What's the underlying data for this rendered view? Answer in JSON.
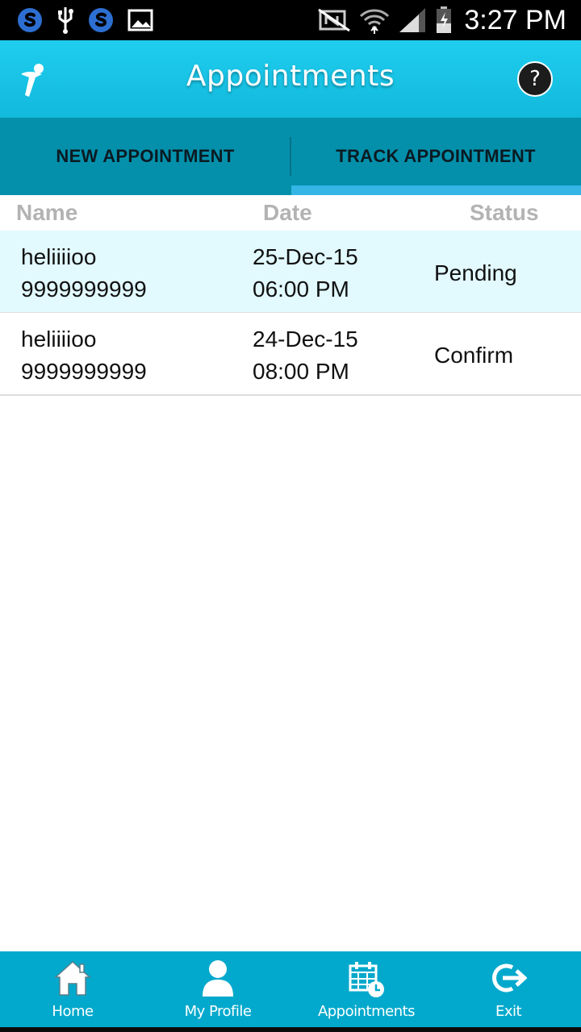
{
  "status_bar": {
    "time": "3:27 PM",
    "icons_left": [
      "skype-icon",
      "usb-icon",
      "skype-icon",
      "image-icon"
    ],
    "icons_right": [
      "nfc-off-icon",
      "wifi-icon",
      "signal-icon",
      "battery-charging-icon"
    ]
  },
  "app_bar": {
    "title": "Appointments",
    "help_label": "?",
    "color_top": "#1fcdee",
    "color_bottom": "#12b9dc"
  },
  "tabs": [
    {
      "label": "NEW APPOINTMENT",
      "selected": false
    },
    {
      "label": "TRACK APPOINTMENT",
      "selected": true
    }
  ],
  "table": {
    "columns": [
      "Name",
      "Date",
      "Status"
    ],
    "rows": [
      {
        "name": "heliiiioo",
        "phone": "9999999999",
        "date": "25-Dec-15",
        "time": "06:00 PM",
        "status": "Pending"
      },
      {
        "name": "heliiiioo",
        "phone": "9999999999",
        "date": "24-Dec-15",
        "time": "08:00 PM",
        "status": "Confirm"
      }
    ]
  },
  "bottom_nav": [
    {
      "label": "Home",
      "icon": "home-icon"
    },
    {
      "label": "My Profile",
      "icon": "user-icon"
    },
    {
      "label": "Appointments",
      "icon": "calendar-clock-icon"
    },
    {
      "label": "Exit",
      "icon": "exit-icon"
    }
  ],
  "colors": {
    "accent": "#33b5e5",
    "tab_bar": "#0490ab",
    "bottom_nav": "#03a9cc",
    "highlight_row": "#e2f9fe"
  }
}
